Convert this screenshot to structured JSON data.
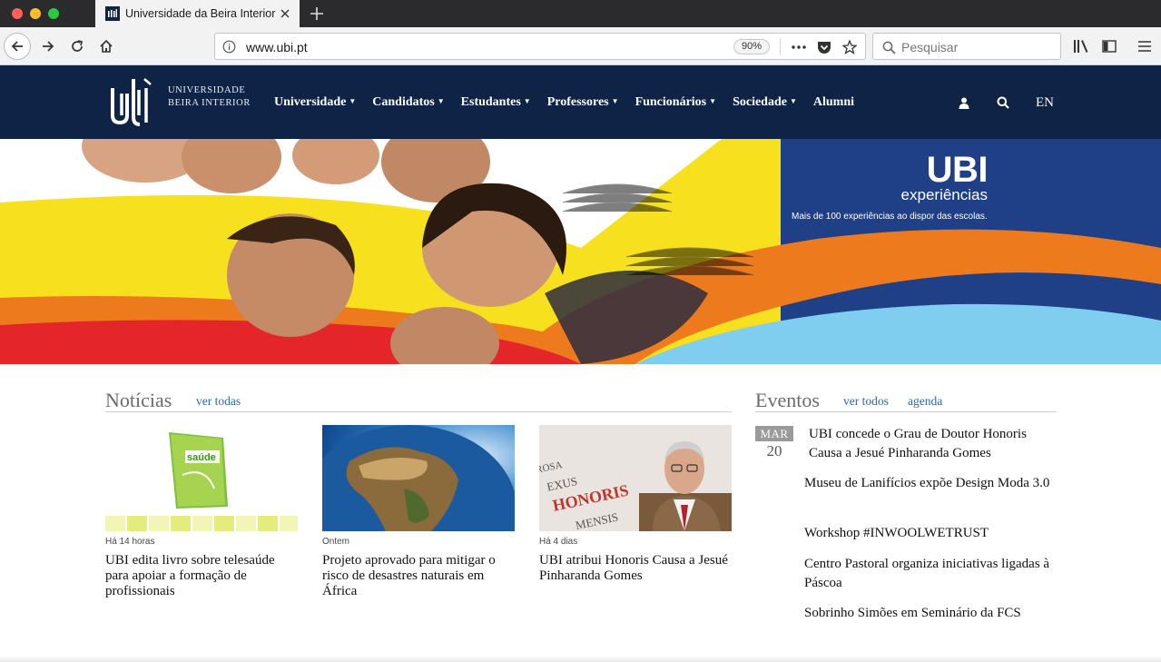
{
  "browser": {
    "tab_title": "Universidade da Beira Interior",
    "url": "www.ubi.pt",
    "zoom": "90%",
    "search_placeholder": "Pesquisar"
  },
  "site": {
    "logo_line1": "UNIVERSIDADE",
    "logo_line2": "BEIRA INTERIOR",
    "menu": [
      {
        "label": "Universidade",
        "dropdown": true
      },
      {
        "label": "Candidatos",
        "dropdown": true
      },
      {
        "label": "Estudantes",
        "dropdown": true
      },
      {
        "label": "Professores",
        "dropdown": true
      },
      {
        "label": "Funcionários",
        "dropdown": true
      },
      {
        "label": "Sociedade",
        "dropdown": true
      },
      {
        "label": "Alumni",
        "dropdown": false
      }
    ],
    "lang": "EN"
  },
  "hero": {
    "brand": "UBI",
    "subtitle": "experiências",
    "tagline": "Mais de 100 experiências ao dispor das escolas."
  },
  "news": {
    "title": "Notícias",
    "link": "ver todas",
    "items": [
      {
        "time": "Há 14 horas",
        "title": "UBI edita livro sobre telesaúde para apoiar a formação de profissionais",
        "thumb_text": "saúde"
      },
      {
        "time": "Ontem",
        "title": "Projeto aprovado para mitigar o risco de desastres naturais em África"
      },
      {
        "time": "Há 4 dias",
        "title": "UBI atribui Honoris Causa a Jesué Pinharanda Gomes",
        "thumb_words": [
          "ROSA",
          "EXUS",
          "HONORIS",
          "MENSIS"
        ]
      }
    ]
  },
  "events": {
    "title": "Eventos",
    "link_all": "ver todos",
    "link_agenda": "agenda",
    "date_month": "MAR",
    "date_day": "20",
    "items": [
      "UBI concede o Grau de Doutor Honoris Causa a Jesué Pinharanda Gomes",
      "Museu de Lanifícios expõe Design Moda 3.0",
      "Workshop #INWOOLWETRUST",
      "Centro Pastoral organiza iniciativas ligadas à Páscoa",
      "Sobrinho Simões em Seminário da FCS"
    ]
  },
  "colors": {
    "header_bg": "#0f2346",
    "link": "#2a6ab0",
    "hero_blue": "#1f3f86",
    "hero_yellow": "#f7e11e",
    "hero_orange": "#ee7a1e",
    "hero_red": "#e4252a",
    "hero_light_blue": "#7fcdef"
  }
}
